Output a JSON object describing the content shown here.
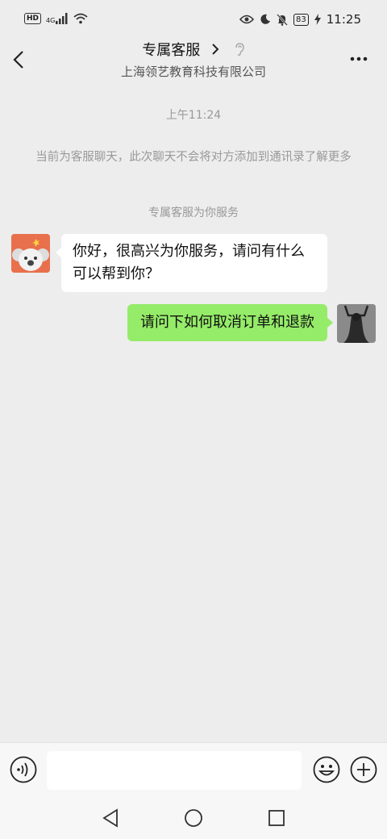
{
  "status_bar": {
    "hd": "HD",
    "network": "4G",
    "battery": "83",
    "time": "11:25"
  },
  "header": {
    "title": "专属客服",
    "subtitle": "上海领艺教育科技有限公司"
  },
  "chat": {
    "timestamp": "上午11:24",
    "notice_text": "当前为客服聊天，此次聊天不会将对方添加到通讯录了解更多",
    "service_text": "专属客服为你服务",
    "messages": [
      {
        "from": "agent",
        "text": "你好，很高兴为你服务，请问有什么可以帮到你？"
      },
      {
        "from": "me",
        "text": "请问下如何取消订单和退款"
      }
    ]
  },
  "input": {
    "placeholder": "",
    "value": ""
  },
  "colors": {
    "background": "#ededed",
    "my_bubble": "#95ec69",
    "agent_avatar": "#e8704d"
  }
}
